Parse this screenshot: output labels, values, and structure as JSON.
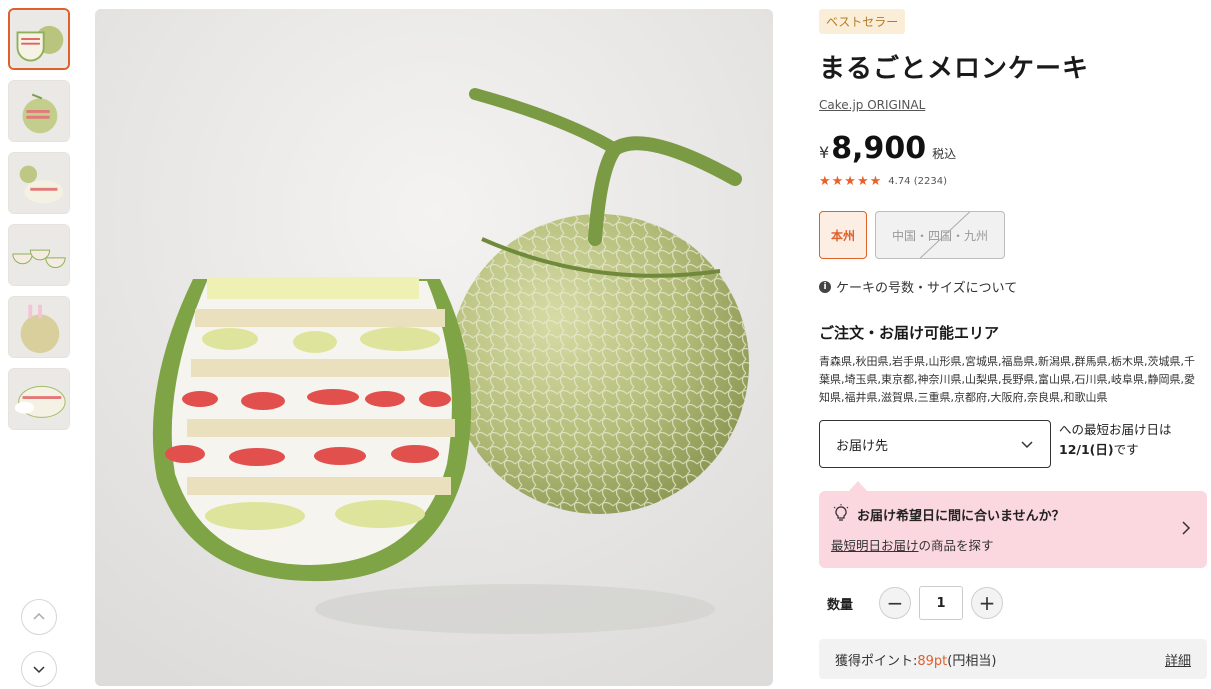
{
  "thumbnails": [
    {
      "name": "thumb-1",
      "active": true
    },
    {
      "name": "thumb-2",
      "active": false
    },
    {
      "name": "thumb-3",
      "active": false
    },
    {
      "name": "thumb-4",
      "active": false
    },
    {
      "name": "thumb-5",
      "active": false
    },
    {
      "name": "thumb-6",
      "active": false
    }
  ],
  "product": {
    "badge": "ベストセラー",
    "title": "まるごとメロンケーキ",
    "brand": "Cake.jp ORIGINAL",
    "currency": "¥",
    "price": "8,900",
    "tax": "税込",
    "stars": "★★★★★",
    "rating": "4.74 (2234)"
  },
  "regions": {
    "selected": "本州",
    "disabled": "中国・四国・九州"
  },
  "size_info": "ケーキの号数・サイズについて",
  "area": {
    "title": "ご注文・お届け可能エリア",
    "text": "青森県,秋田県,岩手県,山形県,宮城県,福島県,新潟県,群馬県,栃木県,茨城県,千葉県,埼玉県,東京都,神奈川県,山梨県,長野県,富山県,石川県,岐阜県,静岡県,愛知県,福井県,滋賀県,三重県,京都府,大阪府,奈良県,和歌山県"
  },
  "delivery": {
    "select_label": "お届け先",
    "note_line1": "への最短お届け日は",
    "note_date": "12/1(日)",
    "note_suffix": "です"
  },
  "alert": {
    "title": "お届け希望日に間に合いませんか？",
    "link_text": "最短明日お届け",
    "link_suffix": "の商品を探す"
  },
  "quantity": {
    "label": "数量",
    "minus": "−",
    "value": "1",
    "plus": "+"
  },
  "points": {
    "label": "獲得ポイント:",
    "value": "89pt",
    "suffix": "(円相当)",
    "detail": "詳細"
  },
  "colors": {
    "accent": "#e0602a",
    "alert_bg": "#fbd7df",
    "badge_bg": "#fbeed9"
  }
}
